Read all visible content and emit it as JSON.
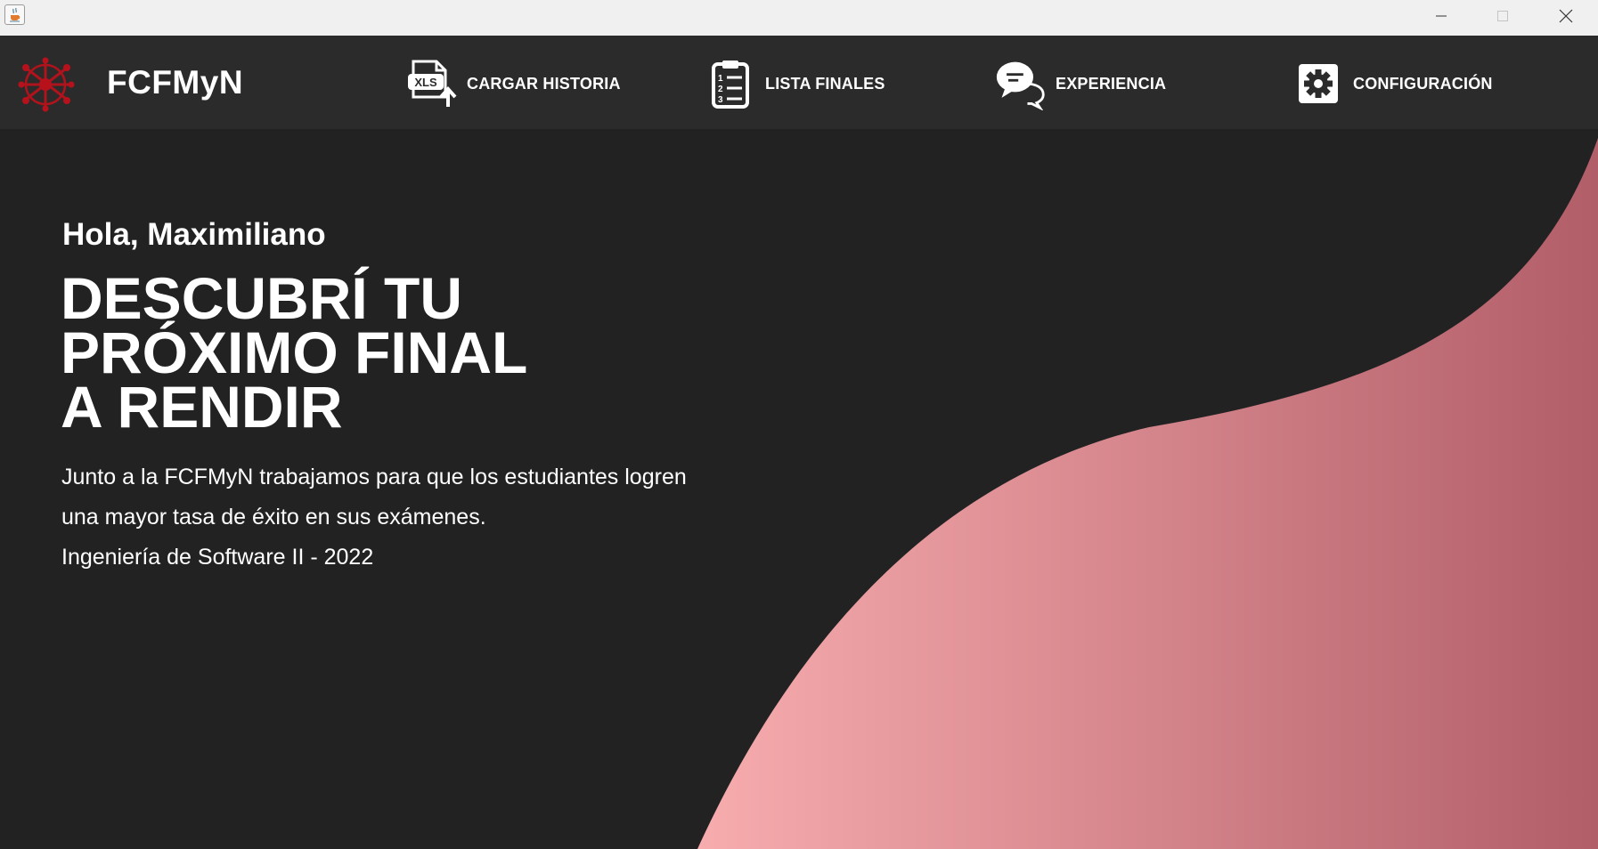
{
  "window": {
    "app_icon": "java-cup-icon",
    "controls": {
      "minimize": "minimize-icon",
      "maximize": "maximize-icon",
      "close": "close-icon"
    }
  },
  "header": {
    "logo_icon": "network-star-logo",
    "brand": "FCFMyN",
    "nav": [
      {
        "label": "CARGAR HISTORIA",
        "icon": "xls-upload-icon"
      },
      {
        "label": "LISTA FINALES",
        "icon": "clipboard-list-icon"
      },
      {
        "label": "EXPERIENCIA",
        "icon": "chat-bubbles-icon"
      },
      {
        "label": "CONFIGURACIÓN",
        "icon": "gear-icon"
      }
    ]
  },
  "hero": {
    "greeting": "Hola, Maximiliano",
    "headline": [
      "DESCUBRÍ TU",
      "PRÓXIMO FINAL",
      "A RENDIR"
    ],
    "description": [
      "Junto a la FCFMyN trabajamos para que los estudiantes logren",
      "una mayor tasa de éxito en sus exámenes.",
      "Ingeniería de Software II - 2022"
    ]
  },
  "colors": {
    "background": "#222222",
    "header_bg": "#2b2b2b",
    "titlebar_bg": "#f0f0f0",
    "wave_light": "#f7acae",
    "wave_dark": "#b25e69",
    "logo_red": "#b7121c",
    "text": "#ffffff"
  }
}
